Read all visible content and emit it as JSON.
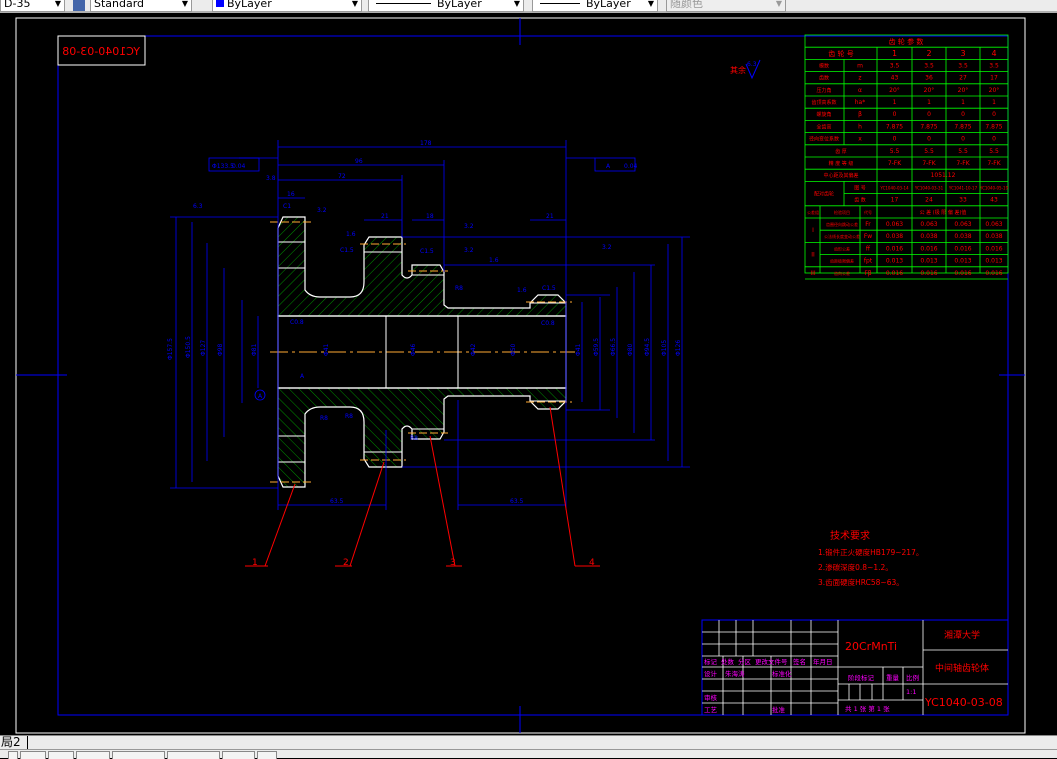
{
  "toolbar": {
    "dimstyle": "D-35",
    "textstyle": "Standard",
    "color": "ByLayer",
    "linetype": "ByLayer",
    "lineweight": "ByLayer",
    "plotstyle": "随颜色"
  },
  "colors": {
    "canvas": "#000000",
    "border": "#0000ff",
    "part": "#ffffff",
    "hatch": "#00cc00",
    "text": "#ff0000",
    "table_grid": "#00ff00",
    "titleblock_label": "#ff00ff",
    "center_line": "#ffaa33"
  },
  "drawing": {
    "mirrored_code": "YC1040-03-08",
    "roughness_other": "其余",
    "roughness_other_value": "6.3",
    "dimensions": [
      "178",
      "96",
      "72",
      "16",
      "3.8",
      "63.5",
      "63.5",
      "21",
      "18",
      "21",
      "6.3",
      "3.2",
      "1.6",
      "3.2",
      "3.2",
      "1.6",
      "3.2",
      "1.6",
      "C1",
      "C1.5",
      "C1.5",
      "C1.5",
      "C0.8",
      "C0.8",
      "Φ157.5",
      "Φ150.5",
      "Φ127",
      "Φ98",
      "Φ81",
      "Φ41",
      "Φ46",
      "Φ42",
      "Φ50",
      "Φ41",
      "Φ59.5",
      "Φ66.5",
      "Φ80",
      "Φ94.5",
      "Φ105",
      "Φ126",
      "Φ133.5",
      "0.04",
      "A",
      "0.04",
      "A",
      "A",
      "R8",
      "R8",
      "R8",
      "R8"
    ],
    "callouts": [
      "1",
      "2",
      "3",
      "4"
    ]
  },
  "gear_table": {
    "title": "齿 轮 参 数",
    "header": [
      "齿 轮 号",
      "1",
      "2",
      "3",
      "4"
    ],
    "rows": [
      {
        "name": "模数",
        "sym": "m",
        "v": [
          "3.5",
          "3.5",
          "3.5",
          "3.5"
        ]
      },
      {
        "name": "齿数",
        "sym": "z",
        "v": [
          "43",
          "36",
          "27",
          "17"
        ]
      },
      {
        "name": "压力角",
        "sym": "α",
        "v": [
          "20°",
          "20°",
          "20°",
          "20°"
        ]
      },
      {
        "name": "齿顶高系数",
        "sym": "ha*",
        "v": [
          "1",
          "1",
          "1",
          "1"
        ]
      },
      {
        "name": "螺旋角",
        "sym": "β",
        "v": [
          "0",
          "0",
          "0",
          "0"
        ]
      },
      {
        "name": "全齿高",
        "sym": "h",
        "v": [
          "7.875",
          "7.875",
          "7.875",
          "7.875"
        ]
      },
      {
        "name": "径向变位系数",
        "sym": "x",
        "v": [
          "0",
          "0",
          "0",
          "0"
        ]
      }
    ],
    "thickness": {
      "name": "齿 厚",
      "v": [
        "5.5",
        "5.5",
        "5.5",
        "5.5"
      ]
    },
    "accuracy": {
      "name": "精 度 等 级",
      "v": [
        "7-FK",
        "7-FK",
        "7-FK",
        "7-FK"
      ]
    },
    "center": {
      "name": "中心距及其偏差",
      "v": "1051.12"
    },
    "mating": {
      "name": "配对齿轮",
      "drawing_label": "图 号",
      "count_label": "齿 数",
      "drawings": [
        "YC1040-03-14",
        "YC1040-03-31",
        "YC1041-10-17",
        "YC1040-05-19"
      ],
      "counts": [
        "17",
        "24",
        "33",
        "43"
      ]
    },
    "tol_header": [
      "公差组",
      "检验项目",
      "代号",
      "公 差 (极 限 偏 差)值"
    ],
    "tol_rows": [
      {
        "group": "I",
        "item": "齿圈径向跳动公差",
        "sym": "Fr",
        "v": [
          "0.063",
          "0.063",
          "0.063",
          "0.063"
        ]
      },
      {
        "group": "",
        "item": "公法线长度变动公差",
        "sym": "Fw",
        "v": [
          "0.038",
          "0.038",
          "0.038",
          "0.038"
        ]
      },
      {
        "group": "II",
        "item": "齿形公差",
        "sym": "ff",
        "v": [
          "0.016",
          "0.016",
          "0.016",
          "0.016"
        ]
      },
      {
        "group": "",
        "item": "齿距极限偏差",
        "sym": "fpt",
        "v": [
          "0.013",
          "0.013",
          "0.013",
          "0.013"
        ]
      },
      {
        "group": "III",
        "item": "齿向公差",
        "sym": "Fβ",
        "v": [
          "0.016",
          "0.016",
          "0.016",
          "0.016"
        ]
      }
    ]
  },
  "tech": {
    "title": "技术要求",
    "items": [
      "1.锻件正火硬度HB179~217。",
      "2.渗碳深度0.8~1.2。",
      "3.齿面硬度HRC58~63。"
    ]
  },
  "title_block": {
    "labels": [
      "标记",
      "处数",
      "分区",
      "更改文件号",
      "签名",
      "年月日"
    ],
    "design": "设计",
    "designer": "朱海涛",
    "standard": "标准化",
    "review": "审核",
    "process": "工艺",
    "approve": "批准",
    "stage": "阶段标记",
    "weight": "重量",
    "scale_label": "比例",
    "scale": "1:1",
    "sheets": "共 1 张  第 1 张",
    "material": "20CrMnTi",
    "school": "湘潭大学",
    "part_name": "中间轴齿轮体",
    "code": "YC1040-03-08"
  },
  "tabs": {
    "layout": "局2"
  }
}
